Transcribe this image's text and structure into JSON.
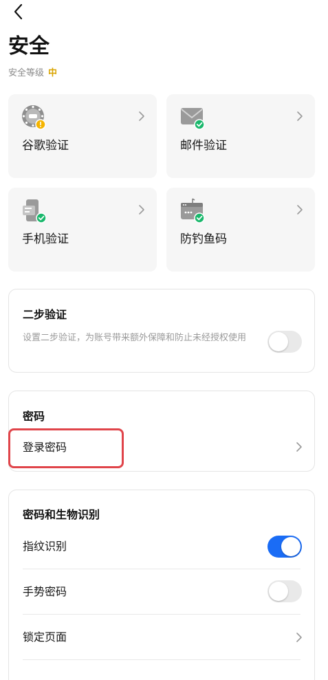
{
  "header": {
    "title": "安全",
    "level_label": "安全等级",
    "level_value": "中"
  },
  "tiles": [
    {
      "label": "谷歌验证",
      "icon": "google-authenticator-icon",
      "status": "warning"
    },
    {
      "label": "邮件验证",
      "icon": "email-icon",
      "status": "verified"
    },
    {
      "label": "手机验证",
      "icon": "phone-icon",
      "status": "verified"
    },
    {
      "label": "防钓鱼码",
      "icon": "anti-phishing-icon",
      "status": "verified"
    }
  ],
  "two_step": {
    "title": "二步验证",
    "description": "设置二步验证，为账号带来额外保障和防止未经授权使用",
    "enabled": false
  },
  "password": {
    "title": "密码",
    "login_password": "登录密码"
  },
  "biometrics": {
    "title": "密码和生物识别",
    "fingerprint": {
      "label": "指纹识别",
      "enabled": true
    },
    "gesture": {
      "label": "手势密码",
      "enabled": false
    },
    "lock_page": {
      "label": "锁定页面"
    }
  },
  "colors": {
    "accent": "#1a6cf5",
    "warning": "#f5b400",
    "success": "#1ab86c",
    "highlight": "#e0444a",
    "level": "#d9a400"
  }
}
